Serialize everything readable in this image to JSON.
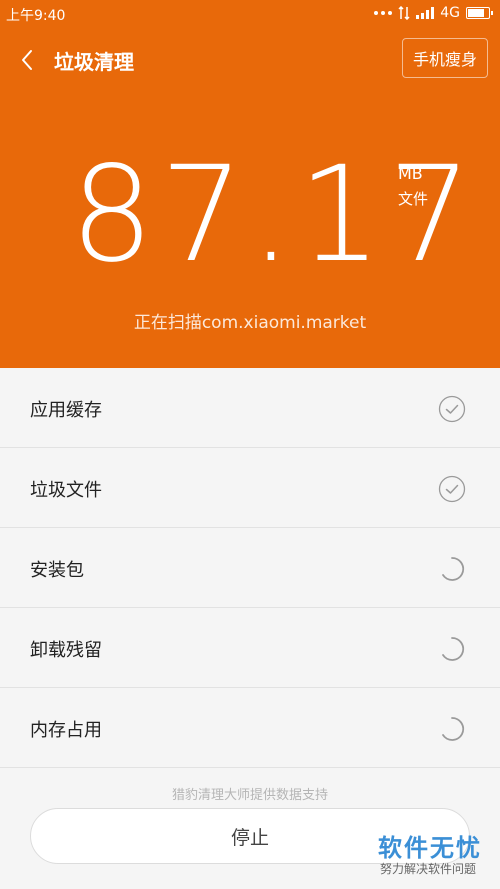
{
  "status_bar": {
    "time": "上午9:40",
    "network": "4G"
  },
  "header": {
    "title": "垃圾清理",
    "slim_button": "手机瘦身"
  },
  "summary": {
    "size_value": "87.17",
    "size_unit": "MB",
    "size_desc": "文件",
    "scanning_text": "正在扫描com.xiaomi.market"
  },
  "items": [
    {
      "label": "应用缓存",
      "state": "done"
    },
    {
      "label": "垃圾文件",
      "state": "done"
    },
    {
      "label": "安装包",
      "state": "loading"
    },
    {
      "label": "卸载残留",
      "state": "loading"
    },
    {
      "label": "内存占用",
      "state": "loading"
    }
  ],
  "footer": {
    "note": "猎豹清理大师提供数据支持",
    "stop_button": "停止"
  },
  "watermark": {
    "title": "软件无忧",
    "subtitle": "努力解决软件问题"
  },
  "colors": {
    "accent": "#e8690a",
    "check": "#9a9a9a"
  }
}
